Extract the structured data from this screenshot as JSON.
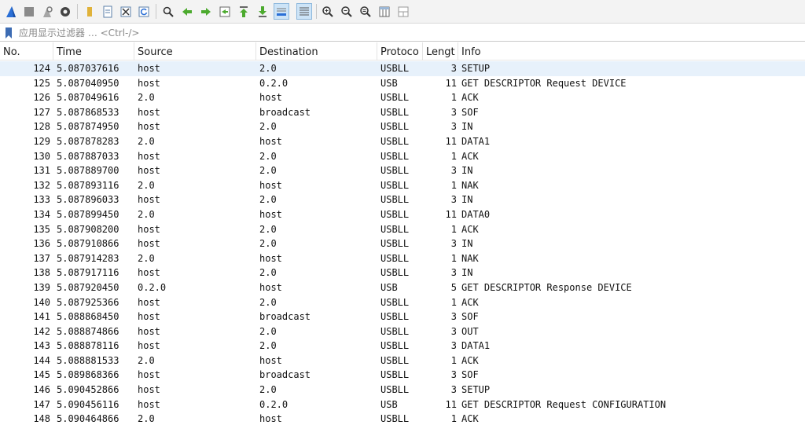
{
  "filter": {
    "placeholder": "应用显示过滤器 … <Ctrl-/>"
  },
  "toolbar": {
    "buttons": [
      {
        "name": "start-capture-icon",
        "color": "#2a6fd6"
      },
      {
        "name": "stop-capture-icon",
        "color": "#7a7a7a"
      },
      {
        "name": "restart-capture-icon",
        "color": "#8a8a8a"
      },
      {
        "name": "capture-options-icon",
        "color": "#444444"
      },
      {
        "name": "open-file-icon",
        "color": "#e0b23a"
      },
      {
        "name": "save-file-icon",
        "color": "#5b7fa8"
      },
      {
        "name": "close-file-icon",
        "color": "#5b7fa8"
      },
      {
        "name": "reload-file-icon",
        "color": "#5b7fa8"
      },
      {
        "name": "find-packet-icon",
        "color": "#333333"
      },
      {
        "name": "go-back-icon",
        "color": "#4caa2e"
      },
      {
        "name": "go-forward-icon",
        "color": "#4caa2e"
      },
      {
        "name": "go-to-packet-icon",
        "color": "#4caa2e"
      },
      {
        "name": "go-first-packet-icon",
        "color": "#4caa2e"
      },
      {
        "name": "go-last-packet-icon",
        "color": "#4caa2e"
      },
      {
        "name": "autoscroll-icon",
        "color": "#2a6fd6"
      },
      {
        "name": "colorize-icon",
        "color": "#555555"
      },
      {
        "name": "zoom-in-icon",
        "color": "#333333"
      },
      {
        "name": "zoom-out-icon",
        "color": "#333333"
      },
      {
        "name": "zoom-normal-icon",
        "color": "#333333"
      },
      {
        "name": "resize-columns-icon",
        "color": "#555555"
      },
      {
        "name": "layout-panes-icon",
        "color": "#777777"
      }
    ]
  },
  "columns": {
    "no": "No.",
    "time": "Time",
    "source": "Source",
    "destination": "Destination",
    "protocol": "Protoco",
    "length": "Lengt",
    "info": "Info"
  },
  "packets": [
    {
      "no": "124",
      "time": "5.087037616",
      "source": "host",
      "destination": "2.0",
      "protocol": "USBLL",
      "length": "3",
      "info": "SETUP",
      "selected": true
    },
    {
      "no": "125",
      "time": "5.087040950",
      "source": "host",
      "destination": "0.2.0",
      "protocol": "USB",
      "length": "11",
      "info": "GET DESCRIPTOR Request DEVICE"
    },
    {
      "no": "126",
      "time": "5.087049616",
      "source": "2.0",
      "destination": "host",
      "protocol": "USBLL",
      "length": "1",
      "info": "ACK"
    },
    {
      "no": "127",
      "time": "5.087868533",
      "source": "host",
      "destination": "broadcast",
      "protocol": "USBLL",
      "length": "3",
      "info": "SOF"
    },
    {
      "no": "128",
      "time": "5.087874950",
      "source": "host",
      "destination": "2.0",
      "protocol": "USBLL",
      "length": "3",
      "info": "IN"
    },
    {
      "no": "129",
      "time": "5.087878283",
      "source": "2.0",
      "destination": "host",
      "protocol": "USBLL",
      "length": "11",
      "info": "DATA1"
    },
    {
      "no": "130",
      "time": "5.087887033",
      "source": "host",
      "destination": "2.0",
      "protocol": "USBLL",
      "length": "1",
      "info": "ACK"
    },
    {
      "no": "131",
      "time": "5.087889700",
      "source": "host",
      "destination": "2.0",
      "protocol": "USBLL",
      "length": "3",
      "info": "IN"
    },
    {
      "no": "132",
      "time": "5.087893116",
      "source": "2.0",
      "destination": "host",
      "protocol": "USBLL",
      "length": "1",
      "info": "NAK"
    },
    {
      "no": "133",
      "time": "5.087896033",
      "source": "host",
      "destination": "2.0",
      "protocol": "USBLL",
      "length": "3",
      "info": "IN"
    },
    {
      "no": "134",
      "time": "5.087899450",
      "source": "2.0",
      "destination": "host",
      "protocol": "USBLL",
      "length": "11",
      "info": "DATA0"
    },
    {
      "no": "135",
      "time": "5.087908200",
      "source": "host",
      "destination": "2.0",
      "protocol": "USBLL",
      "length": "1",
      "info": "ACK"
    },
    {
      "no": "136",
      "time": "5.087910866",
      "source": "host",
      "destination": "2.0",
      "protocol": "USBLL",
      "length": "3",
      "info": "IN"
    },
    {
      "no": "137",
      "time": "5.087914283",
      "source": "2.0",
      "destination": "host",
      "protocol": "USBLL",
      "length": "1",
      "info": "NAK"
    },
    {
      "no": "138",
      "time": "5.087917116",
      "source": "host",
      "destination": "2.0",
      "protocol": "USBLL",
      "length": "3",
      "info": "IN"
    },
    {
      "no": "139",
      "time": "5.087920450",
      "source": "0.2.0",
      "destination": "host",
      "protocol": "USB",
      "length": "5",
      "info": "GET DESCRIPTOR Response DEVICE"
    },
    {
      "no": "140",
      "time": "5.087925366",
      "source": "host",
      "destination": "2.0",
      "protocol": "USBLL",
      "length": "1",
      "info": "ACK"
    },
    {
      "no": "141",
      "time": "5.088868450",
      "source": "host",
      "destination": "broadcast",
      "protocol": "USBLL",
      "length": "3",
      "info": "SOF"
    },
    {
      "no": "142",
      "time": "5.088874866",
      "source": "host",
      "destination": "2.0",
      "protocol": "USBLL",
      "length": "3",
      "info": "OUT"
    },
    {
      "no": "143",
      "time": "5.088878116",
      "source": "host",
      "destination": "2.0",
      "protocol": "USBLL",
      "length": "3",
      "info": "DATA1"
    },
    {
      "no": "144",
      "time": "5.088881533",
      "source": "2.0",
      "destination": "host",
      "protocol": "USBLL",
      "length": "1",
      "info": "ACK"
    },
    {
      "no": "145",
      "time": "5.089868366",
      "source": "host",
      "destination": "broadcast",
      "protocol": "USBLL",
      "length": "3",
      "info": "SOF"
    },
    {
      "no": "146",
      "time": "5.090452866",
      "source": "host",
      "destination": "2.0",
      "protocol": "USBLL",
      "length": "3",
      "info": "SETUP"
    },
    {
      "no": "147",
      "time": "5.090456116",
      "source": "host",
      "destination": "0.2.0",
      "protocol": "USB",
      "length": "11",
      "info": "GET DESCRIPTOR Request CONFIGURATION"
    },
    {
      "no": "148",
      "time": "5.090464866",
      "source": "2.0",
      "destination": "host",
      "protocol": "USBLL",
      "length": "1",
      "info": "ACK"
    }
  ]
}
